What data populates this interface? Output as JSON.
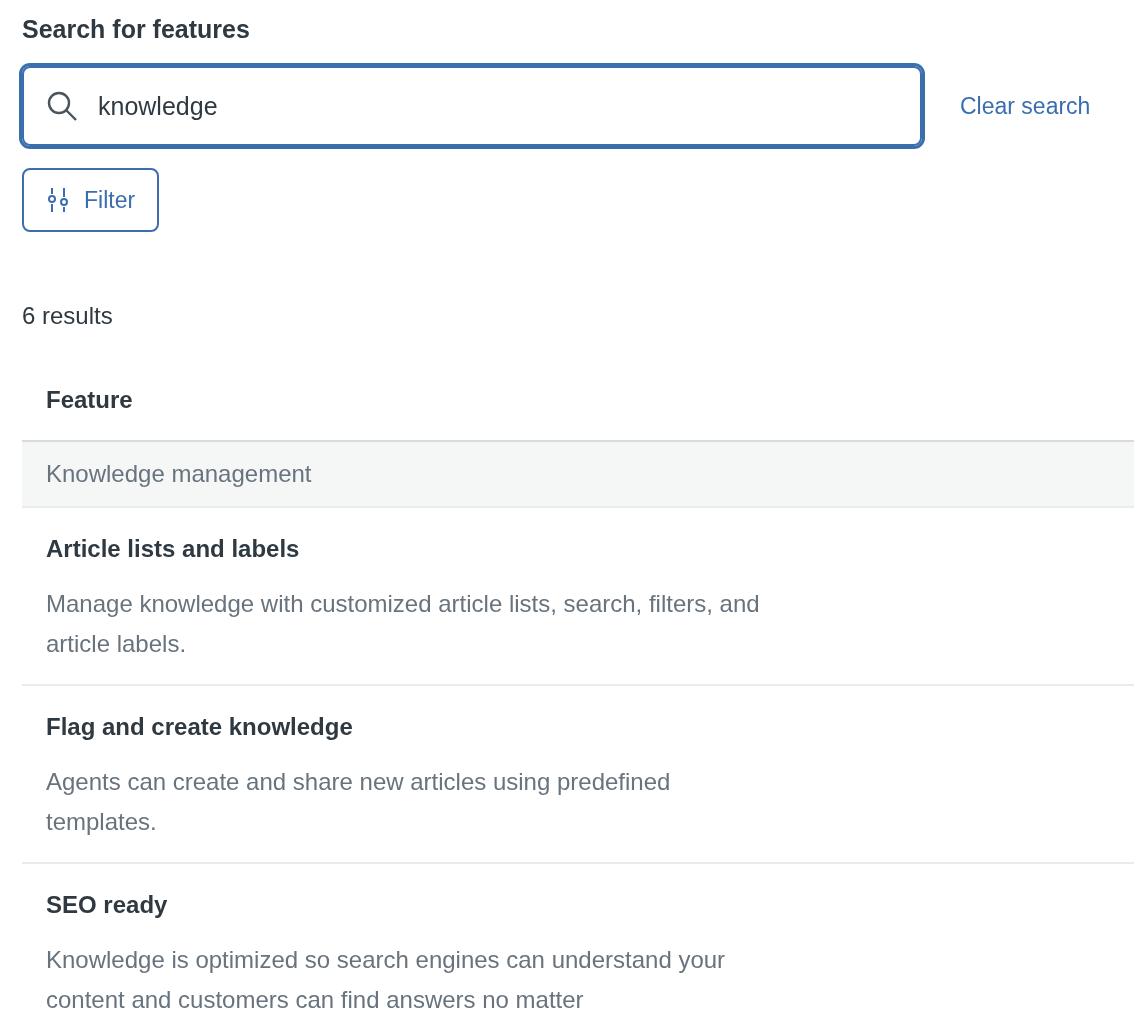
{
  "search": {
    "label": "Search for features",
    "value": "knowledge",
    "focused": true,
    "clear_link": "Clear search"
  },
  "filter_button": "Filter",
  "result_count": "6 results",
  "table": {
    "columns": [
      "Feature"
    ],
    "rows": [
      {
        "kind": "group",
        "title": "Knowledge management"
      },
      {
        "kind": "feature",
        "title": "Article lists and labels",
        "description": "Manage knowledge with customized article lists, search, filters, and article labels."
      },
      {
        "kind": "feature",
        "title": "Flag and create knowledge",
        "description": "Agents can create and share new articles using predefined templates."
      },
      {
        "kind": "feature",
        "title": "SEO ready",
        "description": "Knowledge is optimized so search engines can understand your content and customers can find answers no matter"
      }
    ]
  }
}
